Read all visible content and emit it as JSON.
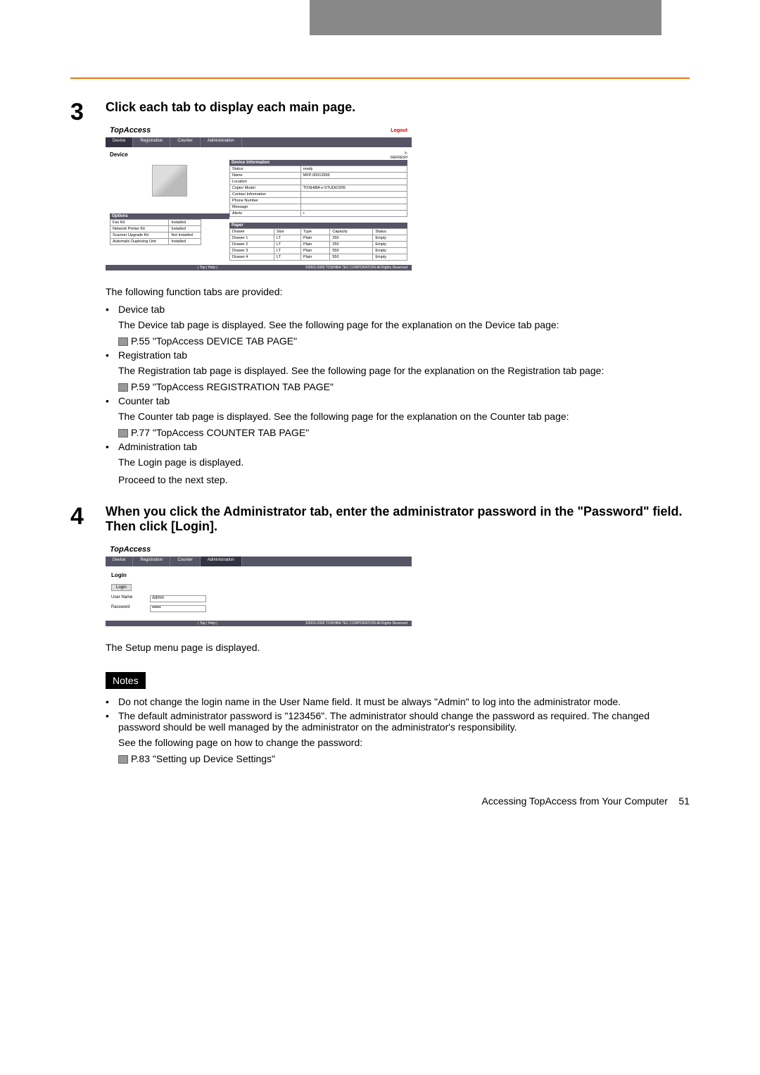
{
  "step3": {
    "number": "3",
    "title": "Click each tab to display each main page.",
    "intro": "The following function tabs are provided:",
    "bullets": [
      {
        "title": "Device tab",
        "desc": "The Device tab page is displayed. See the following page for the explanation on the Device tab page:",
        "ref": "P.55 \"TopAccess DEVICE TAB PAGE\""
      },
      {
        "title": "Registration tab",
        "desc": "The Registration tab page is displayed. See the following page for the explanation on the Registration tab page:",
        "ref": "P.59 \"TopAccess REGISTRATION TAB PAGE\""
      },
      {
        "title": "Counter tab",
        "desc": "The Counter tab page is displayed. See the following page for the explanation on the Counter tab page:",
        "ref": "P.77 \"TopAccess COUNTER TAB PAGE\""
      },
      {
        "title": "Administration tab",
        "desc": "The Login page is displayed.",
        "desc2": "Proceed to the next step."
      }
    ]
  },
  "step4": {
    "number": "4",
    "title": "When you click the Administrator tab, enter the administrator password in the \"Password\" field. Then click [Login].",
    "after": "The Setup menu page is displayed."
  },
  "notes": {
    "header": "Notes",
    "items": [
      "Do not change the login name in the User Name field. It must be always \"Admin\" to log into the administrator mode.",
      "The default administrator password is \"123456\". The administrator should change the password as required. The changed password should be well managed by the administrator on the administrator's responsibility."
    ],
    "extra": "See the following page on how to change the password:",
    "ref": "P.83 \"Setting up Device Settings\""
  },
  "screenshot1": {
    "logo": "TopAccess",
    "logout": "Logout",
    "tabs": [
      "Device",
      "Registration",
      "Counter",
      "Administration"
    ],
    "page_title": "Device",
    "refresh": "REFRESH",
    "device_info_header": "Device Information",
    "device_info": [
      {
        "label": "Status",
        "value": "ready"
      },
      {
        "label": "Name",
        "value": "MFP-00013995"
      },
      {
        "label": "Location",
        "value": ""
      },
      {
        "label": "Copier Model",
        "value": "TOSHIBA e-STUDIO205"
      },
      {
        "label": "Contact Information",
        "value": ""
      },
      {
        "label": "Phone Number",
        "value": ""
      },
      {
        "label": "Message",
        "value": ""
      },
      {
        "label": "Alerts",
        "value": "•"
      }
    ],
    "options_header": "Options",
    "options": [
      {
        "name": "Fax Kit",
        "status": "Installed"
      },
      {
        "name": "Network Printer Kit",
        "status": "Installed"
      },
      {
        "name": "Scanner Upgrade Kit",
        "status": "Not Installed"
      },
      {
        "name": "Automatic Duplexing Unit",
        "status": "Installed"
      }
    ],
    "paper_header": "Paper",
    "paper_cols": [
      "Drawer",
      "Size",
      "Type",
      "Capacity",
      "Status"
    ],
    "paper_rows": [
      {
        "drawer": "Drawer 1",
        "size": "LT",
        "type": "Plain",
        "capacity": "250",
        "status": "Empty"
      },
      {
        "drawer": "Drawer 2",
        "size": "LT",
        "type": "Plain",
        "capacity": "250",
        "status": "Empty"
      },
      {
        "drawer": "Drawer 3",
        "size": "LT",
        "type": "Plain",
        "capacity": "550",
        "status": "Empty"
      },
      {
        "drawer": "Drawer 4",
        "size": "LT",
        "type": "Plain",
        "capacity": "550",
        "status": "Empty"
      }
    ],
    "footer_left": "| Top | Help |",
    "footer_right": "©2003-2005 TOSHIBA TEC CORPORATION All Rights Reserved"
  },
  "screenshot2": {
    "logo": "TopAccess",
    "tabs": [
      "Device",
      "Registration",
      "Counter",
      "Administration"
    ],
    "login_title": "Login",
    "login_btn": "Login",
    "username_label": "User Name",
    "username_value": "Admin",
    "password_label": "Password",
    "password_value": "••••••",
    "footer_left": "| Top | Help |",
    "footer_right": "©2003-2005 TOSHIBA TEC CORPORATION All Rights Reserved"
  },
  "footer": {
    "text": "Accessing TopAccess from Your Computer",
    "page": "51"
  }
}
